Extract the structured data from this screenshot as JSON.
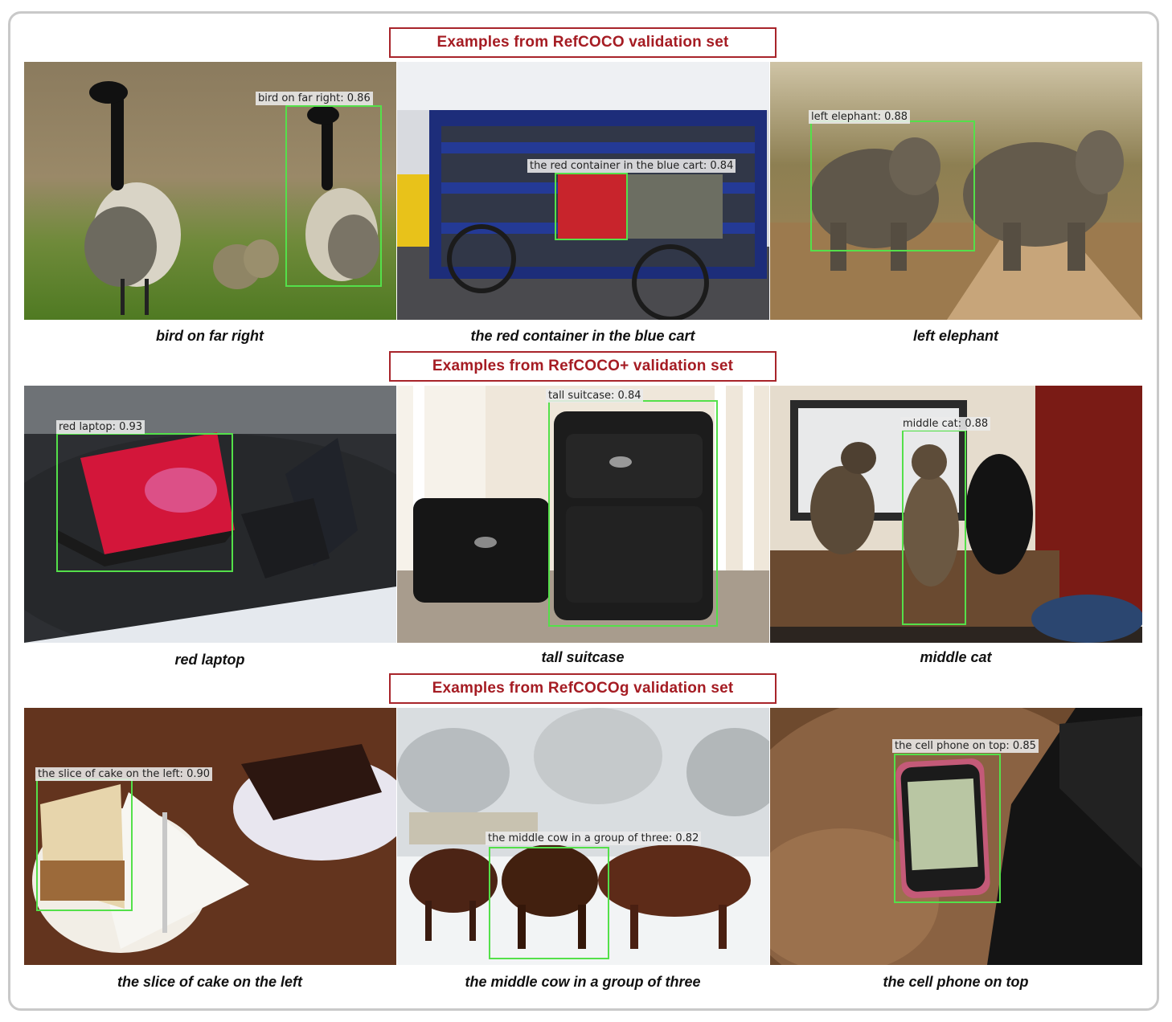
{
  "sections": [
    {
      "title": "Examples from RefCOCO validation set"
    },
    {
      "title": "Examples from RefCOCO+ validation set"
    },
    {
      "title": "Examples from RefCOCOg validation set"
    }
  ],
  "examples": [
    {
      "caption": "bird on far right",
      "label": "bird on far right: 0.86"
    },
    {
      "caption": "the red container in the blue cart",
      "label": "the red container in the blue cart: 0.84"
    },
    {
      "caption": "left elephant",
      "label": "left elephant: 0.88"
    },
    {
      "caption": "red laptop",
      "label": "red laptop: 0.93"
    },
    {
      "caption": "tall suitcase",
      "label": "tall suitcase: 0.84"
    },
    {
      "caption": "middle cat",
      "label": "middle cat: 0.88"
    },
    {
      "caption": "the slice of cake on the left",
      "label": "the slice of cake on the left: 0.90"
    },
    {
      "caption": "the middle cow in a group of three",
      "label": "the middle cow in a group of three: 0.82"
    },
    {
      "caption": "the cell phone on top",
      "label": "the cell phone on top: 0.85"
    }
  ],
  "colors": {
    "title_border": "#a8242a",
    "title_text": "#a51c23",
    "bbox": "#54e04a"
  }
}
